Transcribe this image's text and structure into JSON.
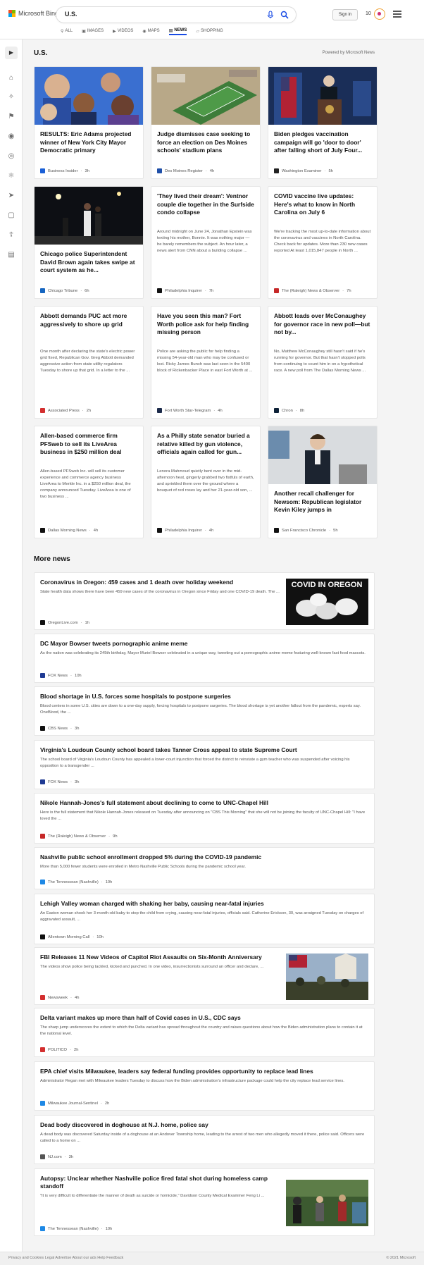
{
  "header": {
    "brand": "Microsoft Bing",
    "query": "U.S.",
    "signin": "Sign in",
    "points": "10",
    "scopes": [
      {
        "label": "ALL",
        "icon": "search-icon"
      },
      {
        "label": "IMAGES",
        "icon": "image-icon"
      },
      {
        "label": "VIDEOS",
        "icon": "video-icon"
      },
      {
        "label": "MAPS",
        "icon": "map-pin-icon"
      },
      {
        "label": "NEWS",
        "icon": "news-icon",
        "active": true
      },
      {
        "label": "SHOPPING",
        "icon": "bag-icon"
      }
    ]
  },
  "section": {
    "title": "U.S.",
    "powered": "Powered by Microsoft News"
  },
  "cards": [
    {
      "title": "RESULTS: Eric Adams projected winner of New York City Mayor Democratic primary",
      "snippet": "",
      "source": "Business Insider",
      "time": "3h",
      "image": "portraits-collage",
      "logo_color": "#1a5fd6"
    },
    {
      "title": "Judge dismisses case seeking to force an election on Des Moines schools' stadium plans",
      "snippet": "",
      "source": "Des Moines Register",
      "time": "4h",
      "image": "stadium-render",
      "logo_color": "#1f4fa8"
    },
    {
      "title": "Biden pledges vaccination campaign will go 'door to door' after falling short of July Four...",
      "snippet": "",
      "source": "Washington Examiner",
      "time": "5h",
      "image": "podium-speech",
      "logo_color": "#222222"
    },
    {
      "title": "Chicago police Superintendent David Brown again takes swipe at court system as he...",
      "snippet": "",
      "source": "Chicago Tribune",
      "time": "6h",
      "image": "night-police",
      "logo_color": "#1565c0"
    },
    {
      "title": "'They lived their dream': Ventnor couple die together in the Surfside condo collapse",
      "snippet": "Around midnight on June 24, Jonathan Epstein was texting his mother, Bonnie. It was nothing major — he barely remembers the subject. An hour later, a news alert from CNN about a building collapse ...",
      "source": "Philadelphia Inquirer",
      "time": "7h",
      "logo_color": "#111111"
    },
    {
      "title": "COVID vaccine live updates: Here's what to know in North Carolina on July 6",
      "snippet": "We're tracking the most up-to-date information about the coronavirus and vaccines in North Carolina. Check back for updates. More than 230 new cases reported At least 1,015,847 people in North ...",
      "source": "The (Raleigh) News & Observer",
      "time": "7h",
      "logo_color": "#c62828"
    },
    {
      "title": "Abbott demands PUC act more aggressively to shore up grid",
      "snippet": "One month after declaring the state's electric power grid fixed, Republican Gov. Greg Abbott demanded aggressive action from state utility regulators Tuesday to shore up that grid. In a letter to the ...",
      "source": "Associated Press",
      "time": "2h",
      "logo_color": "#d32f2f"
    },
    {
      "title": "Have you seen this man? Fort Worth police ask for help finding missing person",
      "snippet": "Police are asking the public for help finding a missing 54-year-old man who may be confused or lost. Ricky James Bunch was last seen in the 5400 block of Rickenbacker Place in east Fort Worth at ...",
      "source": "Fort Worth Star-Telegram",
      "time": "4h",
      "logo_color": "#1b2a4a"
    },
    {
      "title": "Abbott leads over McConaughey for governor race in new poll—but not by...",
      "snippet": "No, Matthew McConaughey still hasn't said if he's running for governor. But that hasn't stopped polls from continuing to count him in on a hypothetical race. A new poll from The Dallas Morning News ...",
      "source": "Chron",
      "time": "8h",
      "logo_color": "#0d2137"
    },
    {
      "title": "Allen-based commerce firm PFSweb to sell its LiveArea business in $250 million deal",
      "snippet": "Allen-based PFSweb Inc. will sell its customer experience and commerce agency business LiveArea to Merkle Inc. in a $250 million deal, the company announced Tuesday. LiveArea is one of two business ...",
      "source": "Dallas Morning News",
      "time": "4h",
      "logo_color": "#111111"
    },
    {
      "title": "As a Philly state senator buried a relative killed by gun violence, officials again called for gun...",
      "snippet": "Lenora Mahmoud quietly bent over in the mid-afternoon heat, gingerly grabbed two fistfuls of earth, and sprinkled them over the ground where a bouquet of red roses lay and her 21-year-old son, ...",
      "source": "Philadelphia Inquirer",
      "time": "4h",
      "logo_color": "#111111"
    },
    {
      "title": "Another recall challenger for Newsom: Republican legislator Kevin Kiley jumps in",
      "snippet": "",
      "source": "San Francisco Chronicle",
      "time": "5h",
      "image": "speaker-man",
      "logo_color": "#111111"
    }
  ],
  "more_news": {
    "title": "More news",
    "items": [
      {
        "title": "Coronavirus in Oregon: 459 cases and 1 death over holiday weekend",
        "snippet": "State health data shows there have been 459 new cases of the coronavirus in Oregon since Friday and one COVID-19 death. The ...",
        "source": "OregonLive.com",
        "time": "1h",
        "thumb_text": "COVID IN OREGON",
        "logo_color": "#111111"
      },
      {
        "title": "DC Mayor Bowser tweets pornographic anime meme",
        "snippet": "As the nation was celebrating its 245th birthday, Mayor Muriel Bowser celebrated in a unique way, tweeting out a pornographic anime meme featuring well-known fast food mascots.",
        "source": "FOX News",
        "time": "10h",
        "logo_color": "#1f3a93"
      },
      {
        "title": "Blood shortage in U.S. forces some hospitals to postpone surgeries",
        "snippet": "Blood centers in some U.S. cities are down to a one-day supply, forcing hospitals to postpone surgeries. The blood shortage is yet another fallout from the pandemic, experts say. OneBlood, the ...",
        "source": "CBS News",
        "time": "3h",
        "logo_color": "#111111"
      },
      {
        "title": "Virginia's Loudoun County school board takes Tanner Cross appeal to state Supreme Court",
        "snippet": "The school board of Virginia's Loudoun County has appealed a lower-court injunction that forced the district to reinstate a gym teacher who was suspended after voicing his opposition to a transgender ...",
        "source": "FOX News",
        "time": "3h",
        "logo_color": "#1f3a93"
      },
      {
        "title": "Nikole Hannah-Jones's full statement about declining to come to UNC-Chapel Hill",
        "snippet": "Here is the full statement that Nikole Hannah-Jones released on Tuesday after announcing on \"CBS This Morning\" that she will not be joining the faculty of UNC-Chapel Hill: \"I have loved the ...",
        "source": "The (Raleigh) News & Observer",
        "time": "9h",
        "logo_color": "#c62828"
      },
      {
        "title": "Nashville public school enrollment dropped 5% during the COVID-19 pandemic",
        "snippet": "More than 5,000 fewer students were enrolled in Metro Nashville Public Schools during the pandemic school year.",
        "source": "The Tennessean (Nashville)",
        "time": "10h",
        "logo_color": "#1e88e5"
      },
      {
        "title": "Lehigh Valley woman charged with shaking her baby, causing near-fatal injuries",
        "snippet": "An Easton woman shook her 3-month-old baby to stop the child from crying, causing near-fatal injuries, officials said. Catherine Erickson, 30, was arraigned Tuesday on charges of aggravated assault, ...",
        "source": "Allentown Morning Call",
        "time": "10h",
        "logo_color": "#111111"
      },
      {
        "title": "FBI Releases 11 New Videos of Capitol Riot Assaults on Six-Month Anniversary",
        "snippet": "The videos show police being tackled, kicked and punched. In one video, insurrectionists surround an officer and declare, ...",
        "source": "Newsweek",
        "time": "4h",
        "thumb_text": "",
        "logo_color": "#d32f2f"
      },
      {
        "title": "Delta variant makes up more than half of Covid cases in U.S., CDC says",
        "snippet": "The sharp jump underscores the extent to which the Delta variant has spread throughout the country and raises questions about how the Biden administration plans to contain it at the national level.",
        "source": "POLITICO",
        "time": "2h",
        "logo_color": "#d32f2f"
      },
      {
        "title": "EPA chief visits Milwaukee, leaders say federal funding provides opportunity to replace lead lines",
        "snippet": "Administrator Regan met with Milwaukee leaders Tuesday to discuss how the Biden administration's infrastructure package could help the city replace lead service lines.",
        "source": "Milwaukee Journal-Sentinel",
        "time": "2h",
        "logo_color": "#1e88e5"
      },
      {
        "title": "Dead body discovered in doghouse at N.J. home, police say",
        "snippet": "A dead body was discovered Saturday inside of a doghouse at an Andover Township home, leading to the arrest of two men who allegedly moved it there, police said. Officers were called to a home on ...",
        "source": "NJ.com",
        "time": "3h",
        "logo_color": "#555555"
      },
      {
        "title": "Autopsy: Unclear whether Nashville police fired fatal shot during homeless camp standoff",
        "snippet": "\"It is very difficult to differentiate the manner of death as suicide or homicide,\" Davidson County Medical Examiner Feng Li ...",
        "source": "The Tennessean (Nashville)",
        "time": "10h",
        "thumb_text": "",
        "logo_color": "#1e88e5"
      }
    ]
  },
  "footer": {
    "left": "Privacy and Cookies   Legal   Advertise   About our ads   Help   Feedback",
    "right": "© 2021 Microsoft"
  },
  "colors": {
    "accent": "#174ae4",
    "ms_red": "#f25022",
    "ms_green": "#7fba00",
    "ms_blue": "#00a4ef",
    "ms_yellow": "#ffb900"
  }
}
